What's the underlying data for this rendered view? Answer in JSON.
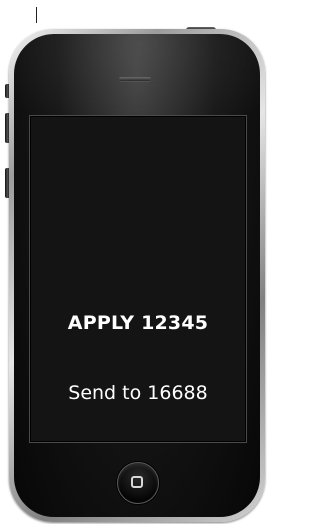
{
  "screen": {
    "headline": "APPLY 12345",
    "subline": "Send to 16688"
  },
  "icons": {
    "home_button": "home-square-icon",
    "speaker": "speaker-grille"
  },
  "colors": {
    "screen_text": "#ffffff",
    "screen_background": "#141414",
    "phone_body": "#0f0f0f"
  }
}
